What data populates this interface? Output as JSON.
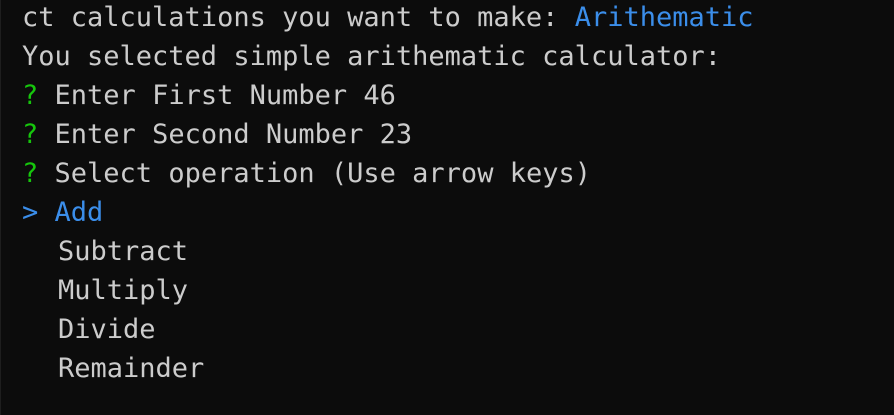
{
  "terminal": {
    "top_line": {
      "prompt_text": "ct calculations you want to make: ",
      "answer": "Arithematic"
    },
    "selected_line": "You selected simple arithematic calculator:",
    "questions": [
      {
        "marker": "?",
        "prompt": "Enter First Number",
        "answer": "46"
      },
      {
        "marker": "?",
        "prompt": "Enter Second Number",
        "answer": "23"
      },
      {
        "marker": "?",
        "prompt": "Select operation",
        "hint": "(Use arrow keys)"
      }
    ],
    "menu": {
      "pointer": ">",
      "selected": "Add",
      "options": [
        "Subtract",
        "Multiply",
        "Divide",
        "Remainder"
      ]
    },
    "colors": {
      "background": "#0c0c0c",
      "text": "#cccccc",
      "question_mark": "#16c60c",
      "accent": "#3b8eea"
    }
  }
}
